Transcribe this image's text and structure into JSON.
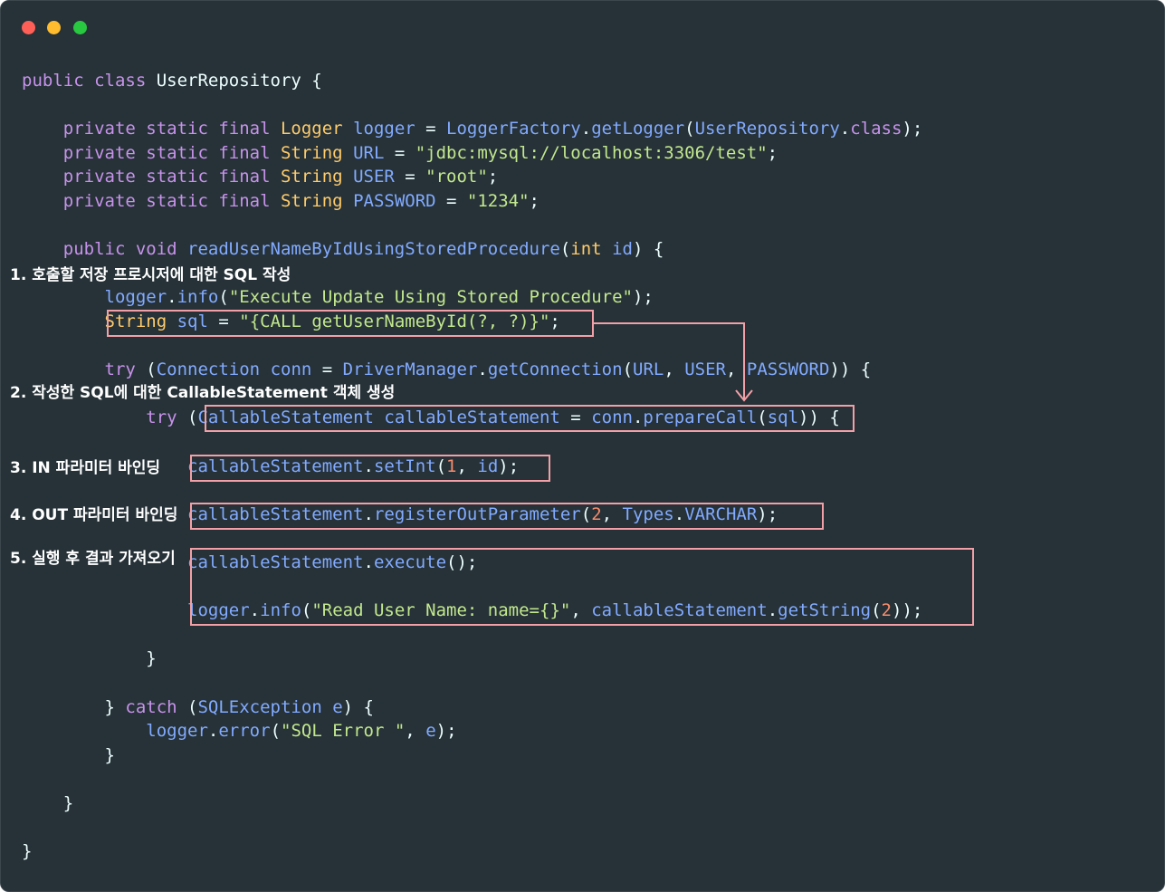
{
  "window": {
    "controls": [
      {
        "name": "close",
        "color": "#ff5f57"
      },
      {
        "name": "minimize",
        "color": "#febc2e"
      },
      {
        "name": "zoom",
        "color": "#28c840"
      }
    ]
  },
  "colors": {
    "background": "#263238",
    "keyword": "#c792ea",
    "type": "#ffcb6b",
    "identifier": "#82aaff",
    "string": "#c3e88d",
    "number": "#f78c6c",
    "highlight_border": "#f2a0a7"
  },
  "annotations": [
    "1. 호출할 저장 프로시저에 대한 SQL 작성",
    "2. 작성한 SQL에 대한 CallableStatement 객체 생성",
    "3. IN 파라미터 바인딩",
    "4. OUT 파라미터 바인딩",
    "5. 실행 후 결과 가져오기"
  ],
  "code": [
    [
      [
        "kw",
        "public class "
      ],
      [
        "tx",
        "UserRepository {"
      ]
    ],
    [],
    [
      [
        "kw",
        "    private static final "
      ],
      [
        "ty",
        "Logger "
      ],
      [
        "id",
        "logger "
      ],
      [
        "tx",
        "= "
      ],
      [
        "id",
        "LoggerFactory"
      ],
      [
        "tx",
        "."
      ],
      [
        "id",
        "getLogger"
      ],
      [
        "tx",
        "("
      ],
      [
        "id",
        "UserRepository"
      ],
      [
        "tx",
        "."
      ],
      [
        "kw",
        "class"
      ],
      [
        "tx",
        ");"
      ]
    ],
    [
      [
        "kw",
        "    private static final "
      ],
      [
        "ty",
        "String "
      ],
      [
        "id",
        "URL "
      ],
      [
        "tx",
        "= "
      ],
      [
        "st",
        "\"jdbc:mysql://localhost:3306/test\""
      ],
      [
        "tx",
        ";"
      ]
    ],
    [
      [
        "kw",
        "    private static final "
      ],
      [
        "ty",
        "String "
      ],
      [
        "id",
        "USER "
      ],
      [
        "tx",
        "= "
      ],
      [
        "st",
        "\"root\""
      ],
      [
        "tx",
        ";"
      ]
    ],
    [
      [
        "kw",
        "    private static final "
      ],
      [
        "ty",
        "String "
      ],
      [
        "id",
        "PASSWORD "
      ],
      [
        "tx",
        "= "
      ],
      [
        "st",
        "\"1234\""
      ],
      [
        "tx",
        ";"
      ]
    ],
    [],
    [
      [
        "kw",
        "    public void "
      ],
      [
        "id",
        "readUserNameByIdUsingStoredProcedure"
      ],
      [
        "tx",
        "("
      ],
      [
        "ty",
        "int "
      ],
      [
        "id",
        "id"
      ],
      [
        "tx",
        ") {"
      ]
    ],
    [],
    [
      [
        "id",
        "        logger"
      ],
      [
        "tx",
        "."
      ],
      [
        "id",
        "info"
      ],
      [
        "tx",
        "("
      ],
      [
        "st",
        "\"Execute Update Using Stored Procedure\""
      ],
      [
        "tx",
        ");"
      ]
    ],
    [
      [
        "ty",
        "        String "
      ],
      [
        "id",
        "sql "
      ],
      [
        "tx",
        "= "
      ],
      [
        "st",
        "\"{CALL getUserNameById(?, ?)}\""
      ],
      [
        "tx",
        ";"
      ]
    ],
    [],
    [
      [
        "kw",
        "        try "
      ],
      [
        "tx",
        "("
      ],
      [
        "id",
        "Connection "
      ],
      [
        "id",
        "conn "
      ],
      [
        "tx",
        "= "
      ],
      [
        "id",
        "DriverManager"
      ],
      [
        "tx",
        "."
      ],
      [
        "id",
        "getConnection"
      ],
      [
        "tx",
        "("
      ],
      [
        "id",
        "URL"
      ],
      [
        "tx",
        ", "
      ],
      [
        "id",
        "USER"
      ],
      [
        "tx",
        ", "
      ],
      [
        "id",
        "PASSWORD"
      ],
      [
        "tx",
        ")) {"
      ]
    ],
    [],
    [
      [
        "kw",
        "            try "
      ],
      [
        "tx",
        "("
      ],
      [
        "id",
        "CallableStatement "
      ],
      [
        "id",
        "callableStatement "
      ],
      [
        "tx",
        "= "
      ],
      [
        "id",
        "conn"
      ],
      [
        "tx",
        "."
      ],
      [
        "id",
        "prepareCall"
      ],
      [
        "tx",
        "("
      ],
      [
        "id",
        "sql"
      ],
      [
        "tx",
        ")) {"
      ]
    ],
    [],
    [
      [
        "id",
        "                callableStatement"
      ],
      [
        "tx",
        "."
      ],
      [
        "id",
        "setInt"
      ],
      [
        "tx",
        "("
      ],
      [
        "nm",
        "1"
      ],
      [
        "tx",
        ", "
      ],
      [
        "id",
        "id"
      ],
      [
        "tx",
        ");"
      ]
    ],
    [],
    [
      [
        "id",
        "                callableStatement"
      ],
      [
        "tx",
        "."
      ],
      [
        "id",
        "registerOutParameter"
      ],
      [
        "tx",
        "("
      ],
      [
        "nm",
        "2"
      ],
      [
        "tx",
        ", "
      ],
      [
        "id",
        "Types"
      ],
      [
        "tx",
        "."
      ],
      [
        "id",
        "VARCHAR"
      ],
      [
        "tx",
        ");"
      ]
    ],
    [],
    [
      [
        "id",
        "                callableStatement"
      ],
      [
        "tx",
        "."
      ],
      [
        "id",
        "execute"
      ],
      [
        "tx",
        "();"
      ]
    ],
    [],
    [
      [
        "id",
        "                logger"
      ],
      [
        "tx",
        "."
      ],
      [
        "id",
        "info"
      ],
      [
        "tx",
        "("
      ],
      [
        "st",
        "\"Read User Name: name={}\""
      ],
      [
        "tx",
        ", "
      ],
      [
        "id",
        "callableStatement"
      ],
      [
        "tx",
        "."
      ],
      [
        "id",
        "getString"
      ],
      [
        "tx",
        "("
      ],
      [
        "nm",
        "2"
      ],
      [
        "tx",
        "));"
      ]
    ],
    [],
    [
      [
        "tx",
        "            }"
      ]
    ],
    [],
    [
      [
        "tx",
        "        } "
      ],
      [
        "kw",
        "catch "
      ],
      [
        "tx",
        "("
      ],
      [
        "id",
        "SQLException "
      ],
      [
        "id",
        "e"
      ],
      [
        "tx",
        ") {"
      ]
    ],
    [
      [
        "id",
        "            logger"
      ],
      [
        "tx",
        "."
      ],
      [
        "id",
        "error"
      ],
      [
        "tx",
        "("
      ],
      [
        "st",
        "\"SQL Error \""
      ],
      [
        "tx",
        ", "
      ],
      [
        "id",
        "e"
      ],
      [
        "tx",
        ");"
      ]
    ],
    [
      [
        "tx",
        "        }"
      ]
    ],
    [],
    [
      [
        "tx",
        "    }"
      ]
    ],
    [],
    [
      [
        "tx",
        "}"
      ]
    ]
  ]
}
